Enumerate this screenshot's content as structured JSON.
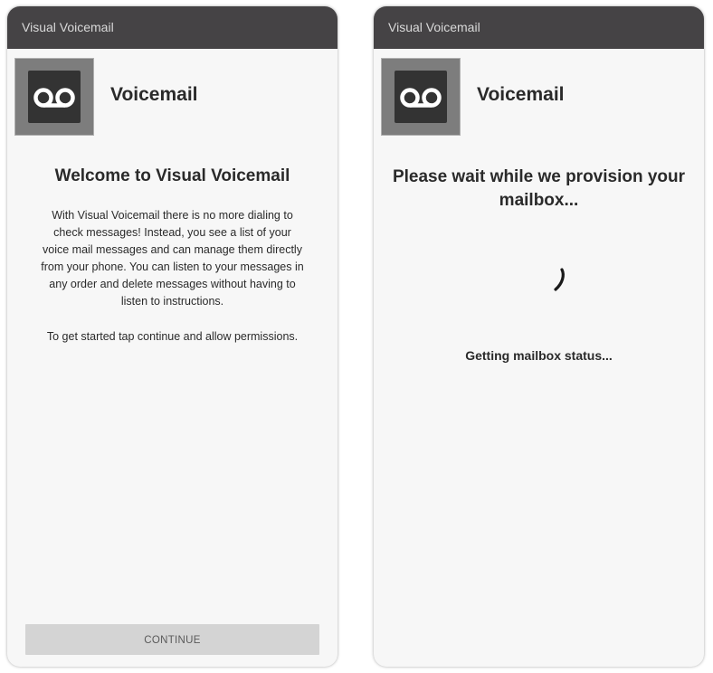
{
  "left_screen": {
    "titlebar": "Visual Voicemail",
    "app_icon": "voicemail-icon",
    "app_name": "Voicemail",
    "welcome_title": "Welcome to Visual Voicemail",
    "welcome_paragraph": "With Visual Voicemail there is no more dialing to check messages! Instead, you see a list of your voice mail messages and can manage them directly from your phone. You can listen to your messages in any order and delete messages without having to listen to instructions.",
    "started_paragraph": "To get started tap continue and allow permissions.",
    "continue_label": "CONTINUE"
  },
  "right_screen": {
    "titlebar": "Visual Voicemail",
    "app_icon": "voicemail-icon",
    "app_name": "Voicemail",
    "provision_title": "Please wait while we provision your mailbox...",
    "spinner_icon": "loading-spinner-icon",
    "status_text": "Getting mailbox status..."
  },
  "colors": {
    "titlebar_bg": "#454345",
    "screen_bg": "#f7f7f7",
    "button_bg": "#d4d4d4",
    "icon_bg": "#7d7d7d",
    "icon_inner": "#333333"
  }
}
